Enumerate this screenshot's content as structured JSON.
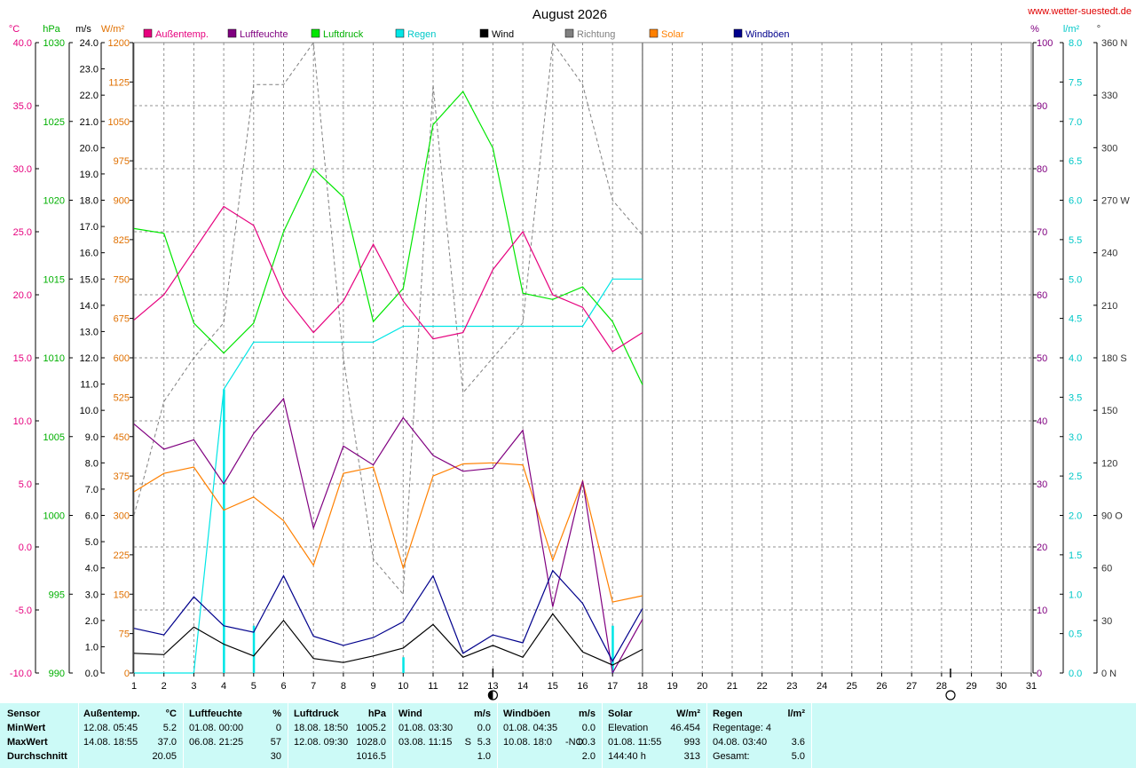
{
  "title": "August 2026",
  "site": "www.wetter-suestedt.de",
  "left_axes": {
    "temp": {
      "unit": "°C",
      "ticks": [
        "40.0",
        "35.0",
        "30.0",
        "25.0",
        "20.0",
        "15.0",
        "10.0",
        "5.0",
        "0.0",
        "-5.0",
        "-10.0"
      ],
      "color": "#e6007e"
    },
    "pressure": {
      "unit": "hPa",
      "ticks": [
        "1030",
        "1025",
        "1020",
        "1015",
        "1010",
        "1005",
        "1000",
        "995",
        "990"
      ],
      "color": "#00c800"
    },
    "wind": {
      "unit": "m/s",
      "ticks": [
        "24.0",
        "23.0",
        "22.0",
        "21.0",
        "20.0",
        "19.0",
        "18.0",
        "17.0",
        "16.0",
        "15.0",
        "14.0",
        "13.0",
        "12.0",
        "11.0",
        "10.0",
        "9.0",
        "8.0",
        "7.0",
        "6.0",
        "5.0",
        "4.0",
        "3.0",
        "2.0",
        "1.0",
        "0.0"
      ],
      "color": "#000000"
    },
    "solar": {
      "unit": "W/m²",
      "ticks": [
        "1200",
        "1125",
        "1050",
        "975",
        "900",
        "825",
        "750",
        "675",
        "600",
        "525",
        "450",
        "375",
        "300",
        "225",
        "150",
        "75",
        "0"
      ],
      "color": "#e07000"
    }
  },
  "right_axes": {
    "humidity": {
      "unit": "%",
      "ticks": [
        "100",
        "90",
        "80",
        "70",
        "60",
        "50",
        "40",
        "30",
        "20",
        "10",
        "0"
      ],
      "color": "#800080"
    },
    "rain": {
      "unit": "l/m²",
      "ticks": [
        "8.0",
        "7.5",
        "7.0",
        "6.5",
        "6.0",
        "5.5",
        "5.0",
        "4.5",
        "4.0",
        "3.5",
        "3.0",
        "2.5",
        "2.0",
        "1.5",
        "1.0",
        "0.5",
        "0.0"
      ],
      "color": "#00c8c8"
    },
    "direction": {
      "unit": "°",
      "ticks": [
        "360 N",
        "330",
        "300",
        "270 W",
        "240",
        "210",
        "180 S",
        "150",
        "120",
        "90 O",
        "60",
        "30",
        "0 N"
      ],
      "color": "#555555"
    }
  },
  "x_ticks": [
    "1",
    "2",
    "3",
    "4",
    "5",
    "6",
    "7",
    "8",
    "9",
    "10",
    "11",
    "12",
    "13",
    "14",
    "15",
    "16",
    "17",
    "18",
    "19",
    "20",
    "21",
    "22",
    "23",
    "24",
    "25",
    "26",
    "27",
    "28",
    "29",
    "30",
    "31"
  ],
  "legend": [
    {
      "label": "Außentemp.",
      "color": "#e6007e"
    },
    {
      "label": "Luftfeuchte",
      "color": "#800080"
    },
    {
      "label": "Luftdruck",
      "color": "#00e600"
    },
    {
      "label": "Regen",
      "color": "#00e6e6"
    },
    {
      "label": "Wind",
      "color": "#000000"
    },
    {
      "label": "Richtung",
      "color": "#808080"
    },
    {
      "label": "Solar",
      "color": "#ff8000"
    },
    {
      "label": "Windböen",
      "color": "#00008c"
    }
  ],
  "chart_data": {
    "type": "line",
    "title": "August 2026",
    "x": [
      1,
      2,
      3,
      4,
      5,
      6,
      7,
      8,
      9,
      10,
      11,
      12,
      13,
      14,
      15,
      16,
      17,
      18
    ],
    "xlim": [
      1,
      31
    ],
    "today_marker": 18,
    "moon_phases": [
      {
        "day": 13.0,
        "phase": "half"
      },
      {
        "day": 28.3,
        "phase": "full"
      }
    ],
    "series": [
      {
        "name": "Außentemp.",
        "axis": "temp",
        "ylim": [
          -10,
          40
        ],
        "color": "#e6007e",
        "values": [
          18.0,
          20.0,
          23.5,
          27.0,
          25.5,
          20.0,
          17.0,
          19.5,
          24.0,
          19.5,
          16.5,
          17.0,
          22.0,
          25.0,
          20.0,
          19.0,
          15.5,
          17.0
        ]
      },
      {
        "name": "Luftfeuchte",
        "axis": "humidity",
        "ylim": [
          0,
          100
        ],
        "color": "#800080",
        "values": [
          39.5,
          35.5,
          37.0,
          30.0,
          38.0,
          43.5,
          23.0,
          36.0,
          33.0,
          40.5,
          34.5,
          32.0,
          32.5,
          38.5,
          10.5,
          30.5,
          0.0,
          8.5
        ]
      },
      {
        "name": "Luftdruck",
        "axis": "pressure",
        "ylim": [
          990,
          1030
        ],
        "color": "#00e600",
        "values": [
          1018.2,
          1017.9,
          1012.2,
          1010.3,
          1012.2,
          1018.0,
          1022.0,
          1020.2,
          1012.3,
          1014.4,
          1024.8,
          1026.9,
          1023.3,
          1014.1,
          1013.7,
          1014.5,
          1012.3,
          1008.3
        ]
      },
      {
        "name": "Regen",
        "axis": "rain",
        "ylim": [
          0,
          8
        ],
        "color": "#00e6e6",
        "values": [
          0.0,
          0.0,
          0.0,
          3.6,
          4.2,
          4.2,
          4.2,
          4.2,
          4.2,
          4.4,
          4.4,
          4.4,
          4.4,
          4.4,
          4.4,
          4.4,
          5.0,
          5.0
        ],
        "daily_bars": [
          0,
          0,
          0,
          3.6,
          0.6,
          0,
          0,
          0,
          0,
          0.2,
          0,
          0,
          0,
          0,
          0,
          0,
          0.6,
          0
        ]
      },
      {
        "name": "Wind",
        "axis": "wind",
        "ylim": [
          0,
          24
        ],
        "color": "#000000",
        "values": [
          0.75,
          0.7,
          1.75,
          1.1,
          0.65,
          2.0,
          0.55,
          0.4,
          0.65,
          0.95,
          1.85,
          0.6,
          1.05,
          0.6,
          2.25,
          0.8,
          0.3,
          0.9
        ]
      },
      {
        "name": "Richtung",
        "axis": "direction",
        "ylim": [
          0,
          360
        ],
        "color": "#808080",
        "values": [
          90,
          155,
          180,
          200,
          336,
          336,
          360,
          180,
          65,
          45,
          336,
          160,
          180,
          200,
          360,
          336,
          270,
          250
        ]
      },
      {
        "name": "Solar",
        "axis": "solar",
        "ylim": [
          0,
          1200
        ],
        "color": "#ff8000",
        "values": [
          345,
          380,
          392,
          310,
          335,
          290,
          205,
          380,
          392,
          200,
          375,
          398,
          400,
          396,
          215,
          365,
          135,
          147
        ]
      },
      {
        "name": "Windböen",
        "axis": "wind",
        "ylim": [
          0,
          24
        ],
        "color": "#00008c",
        "values": [
          1.7,
          1.45,
          2.9,
          1.8,
          1.55,
          3.7,
          1.4,
          1.05,
          1.35,
          1.95,
          3.7,
          0.75,
          1.45,
          1.15,
          3.9,
          2.65,
          0.45,
          2.45
        ]
      }
    ]
  },
  "stats": {
    "sensor": {
      "h": "Sensor",
      "r1": "MinWert",
      "r2": "MaxWert",
      "r3": "Durchschnitt"
    },
    "temp": {
      "h": "Außentemp.",
      "u": "°C",
      "min_t": "12.08.  05:45",
      "min_v": "5.2",
      "max_t": "14.08.  18:55",
      "max_v": "37.0",
      "avg": "20.05"
    },
    "hum": {
      "h": "Luftfeuchte",
      "u": "%",
      "min_t": "01.08.  00:00",
      "min_v": "0",
      "max_t": "06.08.  21:25",
      "max_v": "57",
      "avg": "30"
    },
    "press": {
      "h": "Luftdruck",
      "u": "hPa",
      "min_t": "18.08.  18:50",
      "min_v": "1005.2",
      "max_t": "12.08.  09:30",
      "max_v": "1028.0",
      "avg": "1016.5"
    },
    "wind": {
      "h": "Wind",
      "u": "m/s",
      "min_t": "01.08.  03:30",
      "min_v": "0.0",
      "max_t": "03.08.  11:15",
      "max_dir": "S",
      "max_v": "5.3",
      "avg": "1.0"
    },
    "gust": {
      "h": "Windböen",
      "u": "m/s",
      "min_t": "01.08.  04:35",
      "min_v": "0.0",
      "max_t": "10.08.  18:0",
      "max_dir": "-NO",
      "max_v": "10.3",
      "avg": "2.0"
    },
    "solar": {
      "h": "Solar",
      "u": "W/m²",
      "l1": "Elevation",
      "v1": "46.454",
      "l2": "01.08.  11:55",
      "v2": "993",
      "l3": "144:40 h",
      "v3": "313"
    },
    "rain": {
      "h": "Regen",
      "u": "l/m²",
      "l1": "Regentage: 4",
      "v1": "",
      "l2": "04.08.  03:40",
      "v2": "3.6",
      "l3": "Gesamt:",
      "v3": "5.0"
    }
  }
}
